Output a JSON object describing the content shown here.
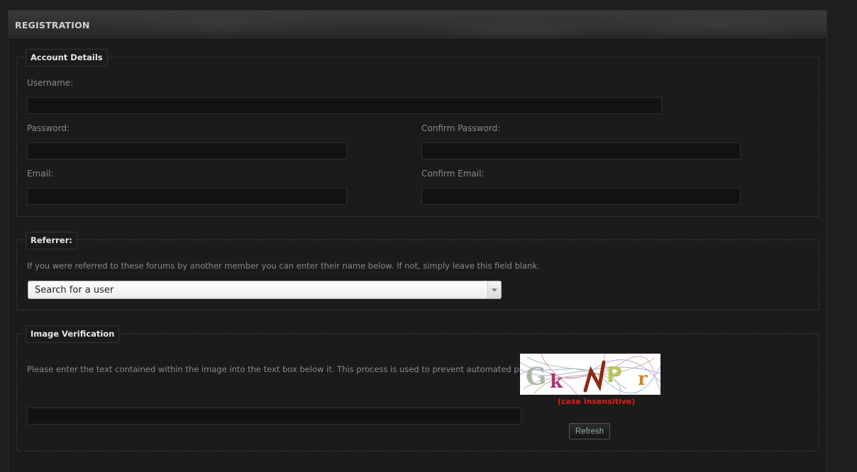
{
  "panel": {
    "title": "REGISTRATION"
  },
  "account": {
    "legend": "Account Details",
    "username_label": "Username:",
    "password_label": "Password:",
    "confirm_password_label": "Confirm Password:",
    "email_label": "Email:",
    "confirm_email_label": "Confirm Email:"
  },
  "referrer": {
    "legend": "Referrer:",
    "description": "If you were referred to these forums by another member you can enter their name below. If not, simply leave this field blank.",
    "select_value": "Search for a user"
  },
  "verification": {
    "legend": "Image Verification",
    "description": "Please enter the text contained within the image into the text box below it. This process is used to prevent automated processes.",
    "captcha_text": "GkNPr",
    "case_note": "(case insensitive)",
    "refresh_label": "Refresh"
  },
  "colors": {
    "background": "#1e1e1e",
    "panel": "#1b1b1b",
    "label": "#8a8a8a",
    "warning": "#e0201a"
  }
}
